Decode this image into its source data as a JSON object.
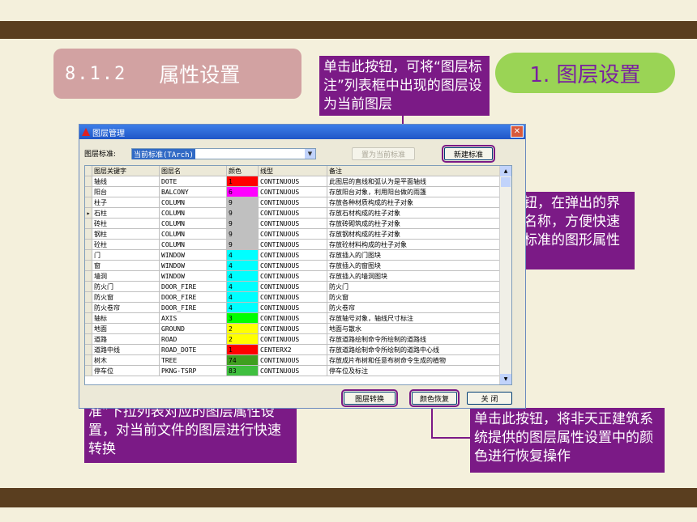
{
  "section": {
    "number": "8.1.2",
    "title": "属性设置"
  },
  "heading_pill": "1. 图层设置",
  "callouts": {
    "set_current": "单击此按钮，可将“图层标注”列表框中出现的图层设为当前图层",
    "new_standard": "单击此按钮，在弹出的界面中输入名称，方便快速新建另外标准的图形属性设置文件",
    "convert": "单击此按钮，将使用“图层标准”下拉列表对应的图层属性设置，对当前文件的图层进行快速转换",
    "restore_color": "单击此按钮，将非天正建筑系统提供的图层属性设置中的颜色进行恢复操作"
  },
  "dialog": {
    "title": "图层管理",
    "close_label": "✕",
    "standard_label": "图层标准:",
    "standard_value": "当前标准(TArch)",
    "set_current_button": "置为当前标准",
    "new_standard_button": "新建标准",
    "convert_button": "图层转换",
    "restore_button": "颜色恢复",
    "close_button": "关 闭",
    "columns": [
      "图层关键字",
      "图层名",
      "颜色",
      "线型",
      "备注"
    ],
    "rows": [
      {
        "key": "轴线",
        "name": "DOTE",
        "color": "1",
        "color_hex": "#ff0000",
        "linetype": "CONTINUOUS",
        "note": "此图层的直线和弧认为是平面轴线"
      },
      {
        "key": "阳台",
        "name": "BALCONY",
        "color": "6",
        "color_hex": "#ff00ff",
        "linetype": "CONTINUOUS",
        "note": "存放阳台对象，利用阳台做的雨篷"
      },
      {
        "key": "柱子",
        "name": "COLUMN",
        "color": "9",
        "color_hex": "#c0c0c0",
        "linetype": "CONTINUOUS",
        "note": "存放各种材质构成的柱子对象"
      },
      {
        "key": "石柱",
        "name": "COLUMN",
        "color": "9",
        "color_hex": "#c0c0c0",
        "linetype": "CONTINUOUS",
        "note": "存放石材构成的柱子对象",
        "current": true
      },
      {
        "key": "砖柱",
        "name": "COLUMN",
        "color": "9",
        "color_hex": "#c0c0c0",
        "linetype": "CONTINUOUS",
        "note": "存放砖砌筑成的柱子对象"
      },
      {
        "key": "钢柱",
        "name": "COLUMN",
        "color": "9",
        "color_hex": "#c0c0c0",
        "linetype": "CONTINUOUS",
        "note": "存放钢材构成的柱子对象"
      },
      {
        "key": "砼柱",
        "name": "COLUMN",
        "color": "9",
        "color_hex": "#c0c0c0",
        "linetype": "CONTINUOUS",
        "note": "存放砼材料构成的柱子对象"
      },
      {
        "key": "门",
        "name": "WINDOW",
        "color": "4",
        "color_hex": "#00ffff",
        "linetype": "CONTINUOUS",
        "note": "存放插入的门图块"
      },
      {
        "key": "窗",
        "name": "WINDOW",
        "color": "4",
        "color_hex": "#00ffff",
        "linetype": "CONTINUOUS",
        "note": "存放插入的窗图块"
      },
      {
        "key": "墙洞",
        "name": "WINDOW",
        "color": "4",
        "color_hex": "#00ffff",
        "linetype": "CONTINUOUS",
        "note": "存放插入的墙洞图块"
      },
      {
        "key": "防火门",
        "name": "DOOR_FIRE",
        "color": "4",
        "color_hex": "#00ffff",
        "linetype": "CONTINUOUS",
        "note": "防火门"
      },
      {
        "key": "防火窗",
        "name": "DOOR_FIRE",
        "color": "4",
        "color_hex": "#00ffff",
        "linetype": "CONTINUOUS",
        "note": "防火窗"
      },
      {
        "key": "防火卷帘",
        "name": "DOOR_FIRE",
        "color": "4",
        "color_hex": "#00ffff",
        "linetype": "CONTINUOUS",
        "note": "防火卷帘"
      },
      {
        "key": "轴标",
        "name": "AXIS",
        "color": "3",
        "color_hex": "#00ff00",
        "linetype": "CONTINUOUS",
        "note": "存放轴号对象，轴线尺寸标注"
      },
      {
        "key": "地面",
        "name": "GROUND",
        "color": "2",
        "color_hex": "#ffff00",
        "linetype": "CONTINUOUS",
        "note": "地面与散水"
      },
      {
        "key": "道路",
        "name": "ROAD",
        "color": "2",
        "color_hex": "#ffff00",
        "linetype": "CONTINUOUS",
        "note": "存放道路绘制命令所绘制的道路线"
      },
      {
        "key": "道路中线",
        "name": "ROAD_DOTE",
        "color": "1",
        "color_hex": "#ff0000",
        "linetype": "CENTERX2",
        "note": "存放道路绘制命令所绘制的道路中心线"
      },
      {
        "key": "树木",
        "name": "TREE",
        "color": "74",
        "color_hex": "#3f9f1f",
        "linetype": "CONTINUOUS",
        "note": "存放成片布树和任意布树命令生成的植物"
      },
      {
        "key": "停车位",
        "name": "PKNG-TSRP",
        "color": "83",
        "color_hex": "#3fbf3f",
        "linetype": "CONTINUOUS",
        "note": "停车位及标注"
      }
    ]
  },
  "colors": {
    "callout": "#7b1a86",
    "pill": "#9ad455",
    "title_bg": "#d2a2a2",
    "bar": "#5a3e1f"
  }
}
